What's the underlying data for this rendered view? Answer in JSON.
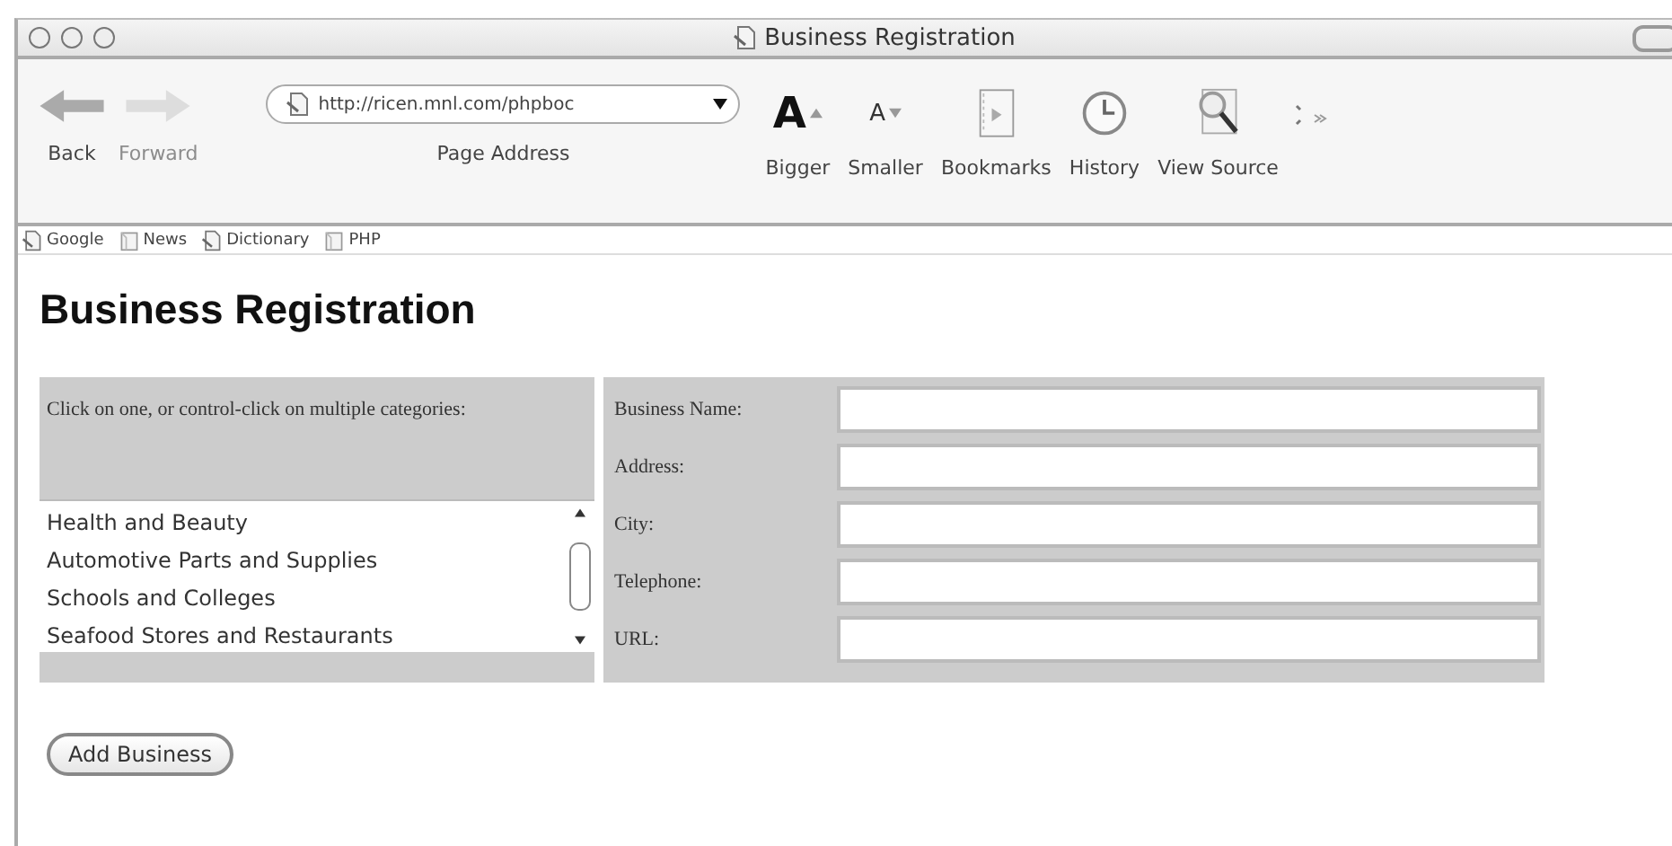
{
  "window": {
    "title": "Business Registration"
  },
  "toolbar": {
    "nav": [
      {
        "kind": "back",
        "label": "Back",
        "disabled": false
      },
      {
        "kind": "forward",
        "label": "Forward",
        "disabled": true
      }
    ],
    "address": {
      "value": "http://ricen.mnl.com/phpboc",
      "label": "Page Address"
    },
    "tools": [
      {
        "kind": "bigger",
        "glyph": "A",
        "label": "Bigger"
      },
      {
        "kind": "smaller",
        "glyph": "A",
        "label": "Smaller"
      },
      {
        "kind": "bookmarks",
        "label": "Bookmarks"
      },
      {
        "kind": "history",
        "label": "History"
      },
      {
        "kind": "source",
        "label": "View Source"
      }
    ]
  },
  "bookmarks_bar": [
    {
      "kind": "page",
      "label": "Google"
    },
    {
      "kind": "folder",
      "label": "News"
    },
    {
      "kind": "page",
      "label": "Dictionary"
    },
    {
      "kind": "folder",
      "label": "PHP"
    }
  ],
  "page": {
    "heading": "Business Registration",
    "instructions": "Click on one, or control-click on multiple categories:",
    "categories": [
      {
        "label": "Health and Beauty",
        "selected": false
      },
      {
        "label": "Automotive Parts and Supplies",
        "selected": false
      },
      {
        "label": "Schools and Colleges",
        "selected": false
      },
      {
        "label": "Seafood Stores and Restaurants",
        "selected": false
      }
    ],
    "fields": [
      {
        "label": "Business Name:"
      },
      {
        "label": "Address:"
      },
      {
        "label": "City:"
      },
      {
        "label": "Telephone:"
      },
      {
        "label": "URL:"
      }
    ],
    "submit": "Add Business"
  }
}
